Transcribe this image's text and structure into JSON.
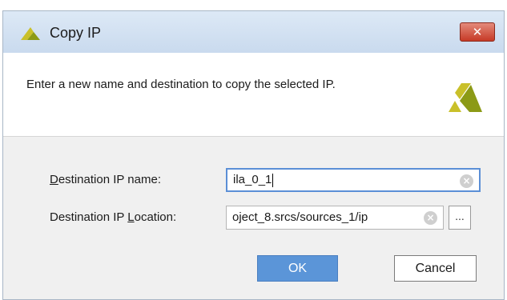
{
  "window": {
    "title": "Copy IP",
    "close_symbol": "✕"
  },
  "header": {
    "description": "Enter a new name and destination to copy the selected IP."
  },
  "form": {
    "name_label_underline": "D",
    "name_label_rest": "estination IP name:",
    "name_value": "ila_0_1",
    "location_label_before": "Destination IP ",
    "location_label_underline": "L",
    "location_label_after": "ocation:",
    "location_value": "oject_8.srcs/sources_1/ip",
    "clear_symbol": "×",
    "browse_label": "..."
  },
  "buttons": {
    "ok": "OK",
    "cancel": "Cancel"
  },
  "colors": {
    "logo_yellow": "#c9c02a",
    "logo_green": "#8c9a16",
    "accent_blue": "#5b95d8",
    "close_red": "#c63a26"
  },
  "icons": {
    "window": "xilinx-logo-icon",
    "header": "xilinx-logo-icon",
    "clear": "clear-icon",
    "browse": "ellipsis-icon"
  }
}
